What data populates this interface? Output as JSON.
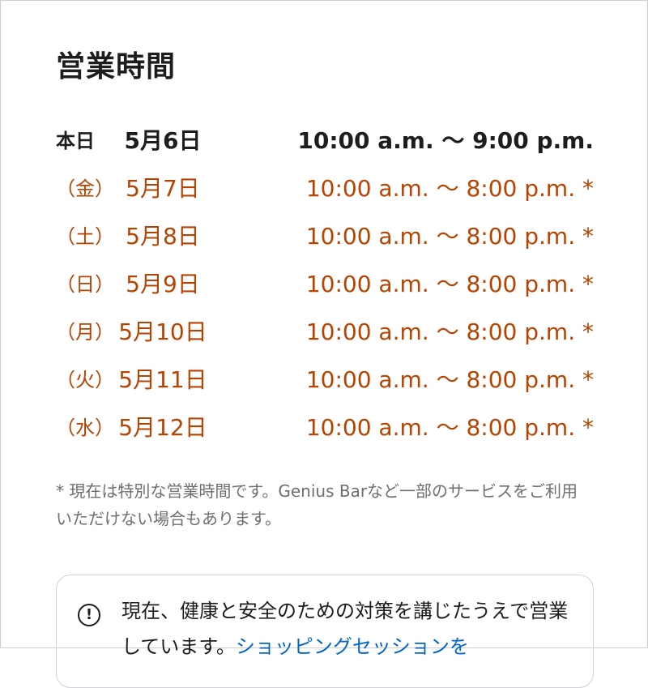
{
  "page_title": "営業時間",
  "hours": [
    {
      "day": "本日",
      "date": "5月6日",
      "time": "10:00 a.m. ～ 9:00 p.m.",
      "today": true
    },
    {
      "day": "（金）",
      "date": "5月7日",
      "time": "10:00 a.m. ～ 8:00 p.m. *",
      "today": false
    },
    {
      "day": "（土）",
      "date": "5月8日",
      "time": "10:00 a.m. ～ 8:00 p.m. *",
      "today": false
    },
    {
      "day": "（日）",
      "date": "5月9日",
      "time": "10:00 a.m. ～ 8:00 p.m. *",
      "today": false
    },
    {
      "day": "（月）",
      "date": "5月10日",
      "time": "10:00 a.m. ～ 8:00 p.m. *",
      "today": false
    },
    {
      "day": "（火）",
      "date": "5月11日",
      "time": "10:00 a.m. ～ 8:00 p.m. *",
      "today": false
    },
    {
      "day": "（水）",
      "date": "5月12日",
      "time": "10:00 a.m. ～ 8:00 p.m. *",
      "today": false
    }
  ],
  "footnote": "* 現在は特別な営業時間です。Genius Barなど一部のサービスをご利用いただけない場合もあります。",
  "notice": {
    "icon": "info-icon",
    "text": "現在、健康と安全のための対策を講じたうえで営業しています。",
    "link_label": "ショッピングセッションを"
  },
  "colors": {
    "special_hours": "#b64400",
    "link": "#0066cc",
    "text": "#1d1d1f",
    "muted": "#6e6e73"
  }
}
